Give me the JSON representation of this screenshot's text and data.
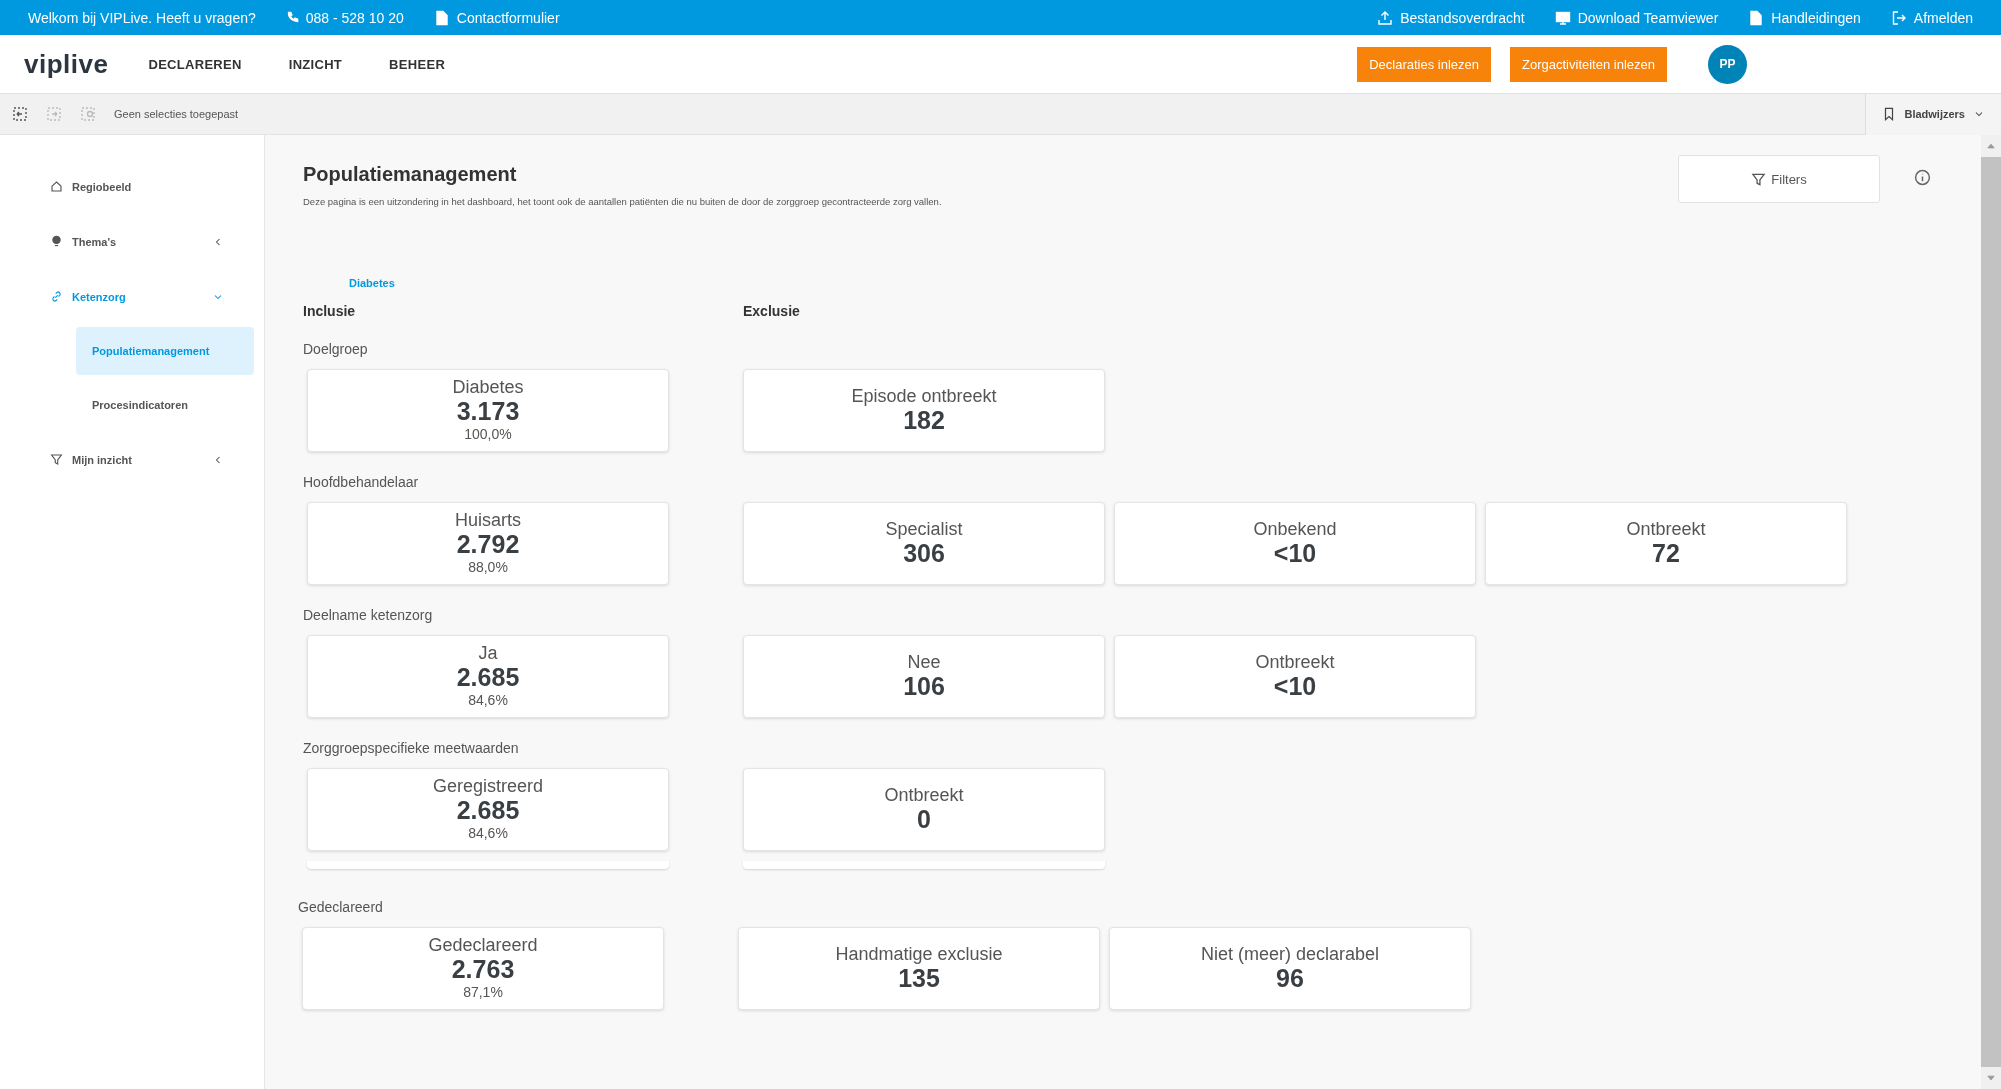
{
  "topbar": {
    "welcome": "Welkom bij VIPLive. Heeft u vragen?",
    "phone": "088 - 528 10 20",
    "contact": "Contactformulier",
    "links": [
      {
        "kind": "upload",
        "label": "Bestandsoverdracht"
      },
      {
        "kind": "monitor",
        "label": "Download Teamviewer"
      },
      {
        "kind": "document",
        "label": "Handleidingen"
      },
      {
        "kind": "logout",
        "label": "Afmelden"
      }
    ]
  },
  "nav": {
    "logo": "viplive",
    "items": [
      "DECLAREREN",
      "INZICHT",
      "BEHEER"
    ],
    "actions": [
      "Declaraties inlezen",
      "Zorgactiviteiten inlezen"
    ],
    "avatar": "PP"
  },
  "toolbar": {
    "status": "Geen selecties toegepast",
    "bookmarks": "Bladwijzers"
  },
  "sidebar": {
    "items": [
      {
        "kind": "home",
        "label": "Regiobeeld",
        "selected": false
      },
      {
        "kind": "bulb",
        "label": "Thema's",
        "selected": false,
        "expanded": false
      },
      {
        "kind": "link",
        "label": "Ketenzorg",
        "selected": true,
        "expanded": true,
        "children": [
          {
            "label": "Populatiemanagement",
            "selected": true
          },
          {
            "label": "Procesindicatoren",
            "selected": false
          }
        ]
      },
      {
        "kind": "filter",
        "label": "Mijn inzicht",
        "selected": false,
        "expanded": false
      }
    ]
  },
  "page": {
    "title": "Populatiemanagement",
    "description": "Deze pagina is een uitzondering in het dashboard, het toont ook de aantallen patiënten die nu buiten de door de zorggroep gecontracteerde zorg vallen.",
    "filters": "Filters",
    "tab": "Diabetes",
    "inclusion_heading": "Inclusie",
    "exclusion_heading": "Exclusie"
  },
  "sections": [
    {
      "label": "Doelgroep",
      "inclusion": [
        {
          "label": "Diabetes",
          "value": "3.173",
          "percent": "100,0%"
        }
      ],
      "exclusion": [
        {
          "label": "Episode ontbreekt",
          "value": "182"
        }
      ]
    },
    {
      "label": "Hoofdbehandelaar",
      "inclusion": [
        {
          "label": "Huisarts",
          "value": "2.792",
          "percent": "88,0%"
        }
      ],
      "exclusion": [
        {
          "label": "Specialist",
          "value": "306"
        },
        {
          "label": "Onbekend",
          "value": "<10"
        },
        {
          "label": "Ontbreekt",
          "value": "72"
        }
      ]
    },
    {
      "label": "Deelname ketenzorg",
      "inclusion": [
        {
          "label": "Ja",
          "value": "2.685",
          "percent": "84,6%"
        }
      ],
      "exclusion": [
        {
          "label": "Nee",
          "value": "106"
        },
        {
          "label": "Ontbreekt",
          "value": "<10"
        }
      ]
    },
    {
      "label": "Zorggroepspecifieke meetwaarden",
      "inclusion": [
        {
          "label": "Geregistreerd",
          "value": "2.685",
          "percent": "84,6%"
        }
      ],
      "exclusion": [
        {
          "label": "Ontbreekt",
          "value": "0"
        }
      ]
    }
  ],
  "declared": {
    "label": "Gedeclareerd",
    "inclusion": [
      {
        "label": "Gedeclareerd",
        "value": "2.763",
        "percent": "87,1%"
      }
    ],
    "exclusion": [
      {
        "label": "Handmatige exclusie",
        "value": "135"
      },
      {
        "label": "Niet (meer) declarabel",
        "value": "96"
      }
    ]
  }
}
